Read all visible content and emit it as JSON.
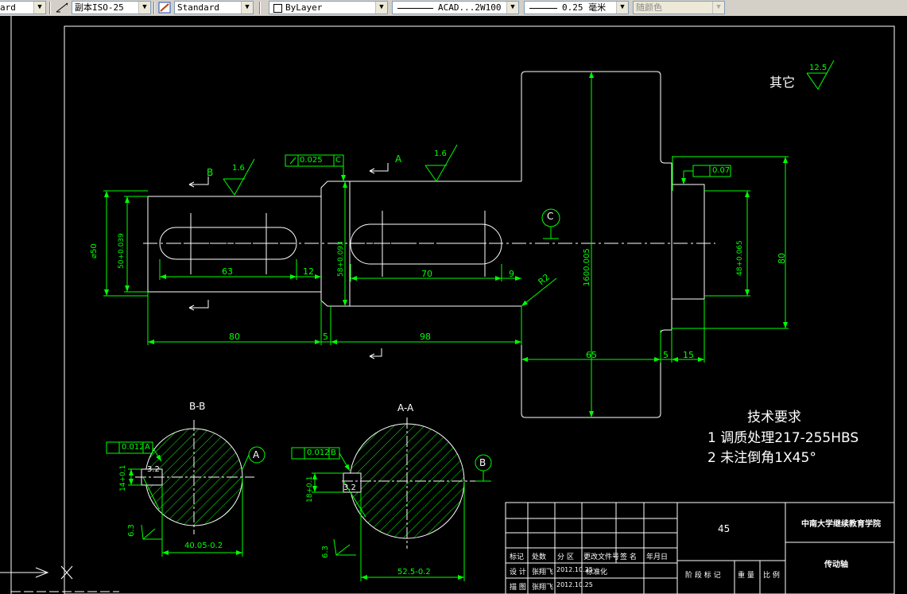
{
  "toolbar": {
    "workspace_fragment": "ard",
    "dim_style": "副本ISO-25",
    "text_style": "Standard",
    "layer_color": "ByLayer",
    "linetype": "ACAD...2W100",
    "lineweight": "0.25 毫米",
    "plot_style": "随颜色"
  },
  "colors": {
    "background": "#000000",
    "outline": "#ffffff",
    "dimension": "#00ff00",
    "hatch": "#00ff00"
  },
  "drawing": {
    "other_finish_label": "其它",
    "other_finish_value": "12.5",
    "surface_finish_1": "1.6",
    "surface_finish_2": "1.6",
    "section_b": "B",
    "section_a": "A",
    "datum_c": "C",
    "runout_c": "0.025",
    "runout_c_ref": "C",
    "circ_runout": "0.07",
    "dim_phi50": "⌀50",
    "dim_50tol": "50+0.039",
    "dim_58tol": "58+0.093",
    "dim_48tol": "48+0.065",
    "dim_160": "160",
    "dim_160tol": "0.005",
    "dim_80v": "80",
    "dim_63": "63",
    "dim_12": "12",
    "dim_70": "70",
    "dim_9": "9",
    "dim_R2": "R2",
    "dim_80h": "80",
    "dim_5a": "5",
    "dim_98": "98",
    "dim_65": "65",
    "dim_5b": "5",
    "dim_15": "15",
    "tech_title": "技术要求",
    "tech_line1": "1 调质处理217-255HBS",
    "tech_line2": "2 未注倒角1X45°",
    "section_bb_title": "B-B",
    "section_aa_title": "A-A",
    "symm_tol_a": "0.012",
    "symm_ref_a": "A",
    "symm_tol_b": "0.012",
    "symm_ref_b": "B",
    "datum_a": "A",
    "datum_b": "B",
    "dim_14": "14+0.1",
    "dim_18": "18+0.1",
    "dim_32a": "3.2",
    "dim_32b": "3.2",
    "dim_63a": "6.3",
    "dim_63b": "6.3",
    "dim_4005": "40.05-0.2",
    "dim_525": "52.5-0.2"
  },
  "title_block": {
    "material": "45",
    "school": "中南大学继续教育学院",
    "part_name": "传动轴",
    "hdr_mark": "标记",
    "hdr_count": "处数",
    "hdr_zone": "分 区",
    "hdr_doc": "更改文件号",
    "hdr_sign": "签 名",
    "hdr_date": "年月日",
    "designer_label": "设 计",
    "designer_name": "张翔飞",
    "designer_date": "2012.10.25",
    "standardize_label": "标准化",
    "drafter_label": "描 图",
    "drafter_name": "张翔飞",
    "drafter_date": "2012.10.25",
    "stage_label": "阶 段 标 记",
    "weight_label": "重 量",
    "scale_label": "比 例"
  }
}
